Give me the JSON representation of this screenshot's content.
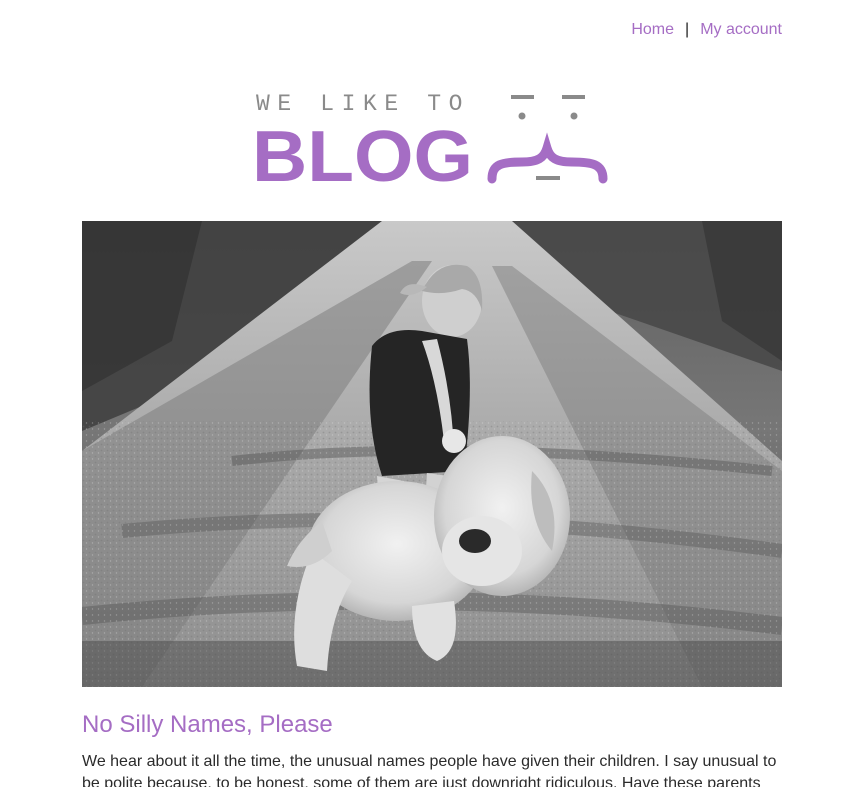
{
  "nav": {
    "home_label": "Home",
    "separator": "|",
    "account_label": "My account"
  },
  "logo": {
    "tagline": "WE LIKE TO",
    "wordmark": "BLOG",
    "mascot_icon": "face-emoticon-icon",
    "tagline_color": "#8a8a8a",
    "wordmark_color": "#a56dc4"
  },
  "hero": {
    "icon": "photo-girl-with-teddy-lion"
  },
  "post": {
    "title": "No Silly Names, Please",
    "excerpt": "We hear about it all the time, the unusual names people have given their children. I say unusual to be polite because, to be honest, some of them are just downright ridiculous. Have these parents"
  },
  "colors": {
    "accent": "#a56dc4",
    "text": "#2b2b2b",
    "background": "#ffffff"
  }
}
